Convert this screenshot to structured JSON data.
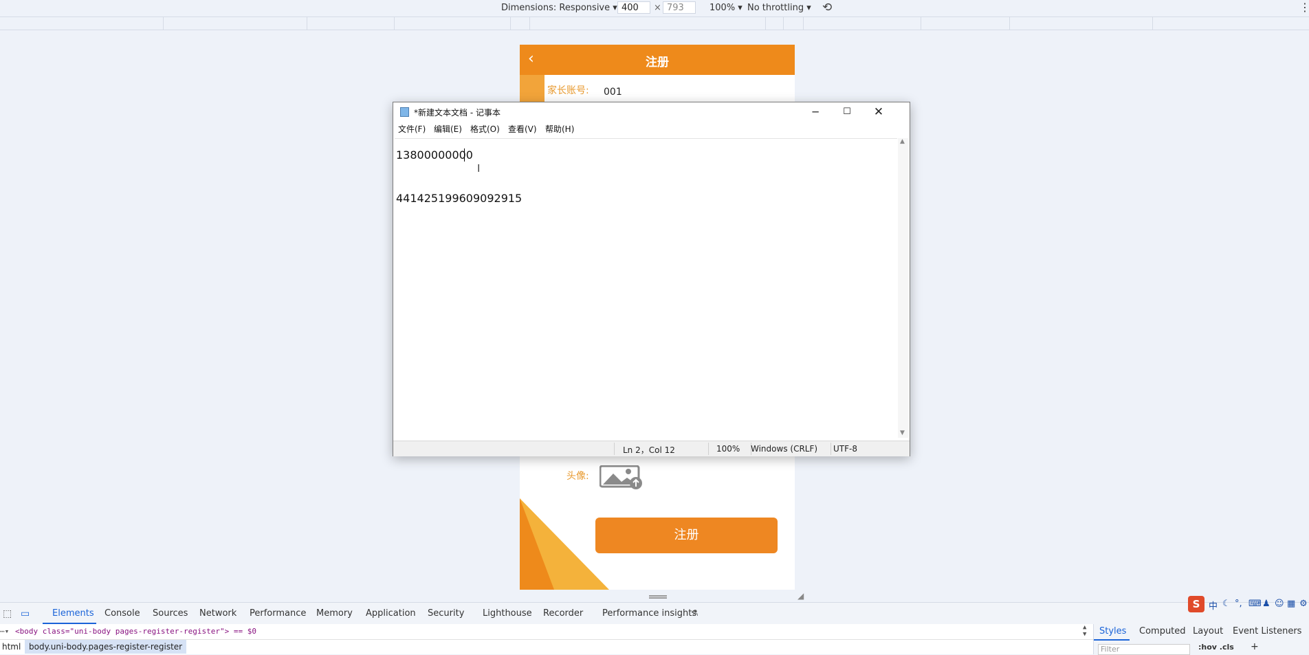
{
  "toolbar": {
    "dimensions": "Dimensions: Responsive ▾",
    "width": "400",
    "times": "×",
    "height": "793",
    "zoom": "100% ▾",
    "throttle": "No throttling ▾"
  },
  "phone": {
    "nav_title": "注册",
    "account_label": "家长账号:",
    "account_value": "001",
    "avatar_label": "头像:",
    "register_button": "注册"
  },
  "notepad": {
    "title": "*新建文本文档 - 记事本",
    "menu": [
      "文件(F)",
      "编辑(E)",
      "格式(O)",
      "查看(V)",
      "帮助(H)"
    ],
    "lines": [
      "13800000000",
      "",
      "441425199609092915"
    ],
    "status": {
      "position": "Ln 2，Col 12",
      "zoom": "100%",
      "eol": "Windows (CRLF)",
      "encoding": "UTF-8"
    }
  },
  "devtools": {
    "tabs": [
      "Elements",
      "Console",
      "Sources",
      "Network",
      "Performance",
      "Memory",
      "Application",
      "Security",
      "Lighthouse",
      "Recorder",
      "Performance insights"
    ],
    "dom_line": "<body class=\"uni-body pages-register-register\"> == $0",
    "crumbs": [
      "html",
      "body.uni-body.pages-register-register"
    ],
    "side_tabs": [
      "Styles",
      "Computed",
      "Layout",
      "Event Listeners"
    ],
    "filter_placeholder": "Filter",
    "filter_tools": ":hov .cls"
  },
  "ime": {
    "lang": "中"
  }
}
